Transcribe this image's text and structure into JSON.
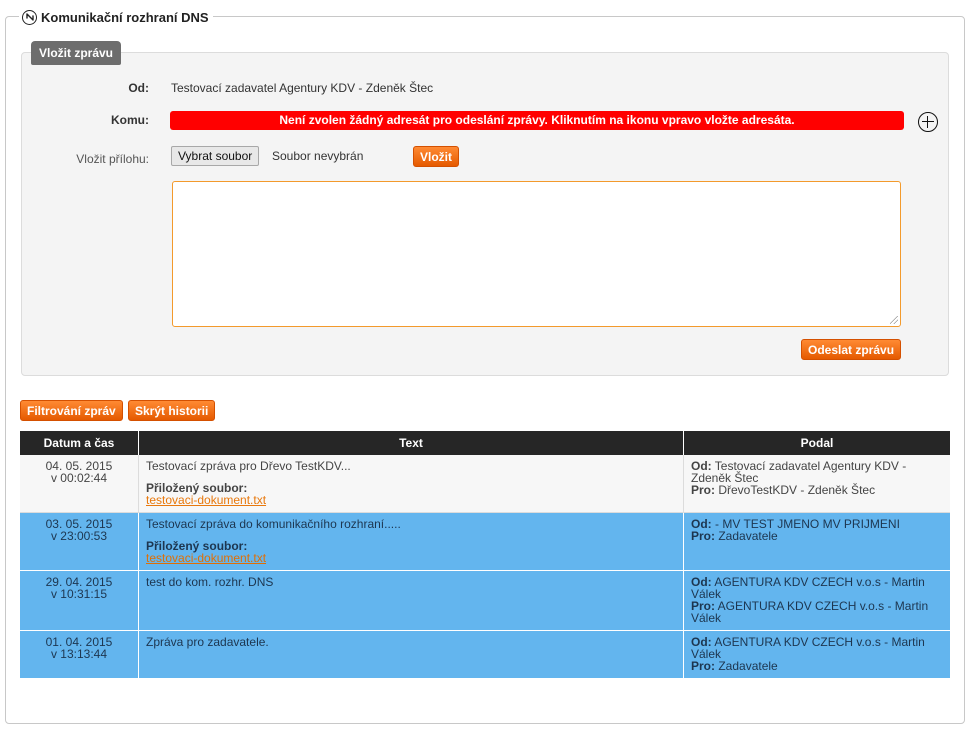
{
  "legend": {
    "title": "Komunikační rozhraní DNS",
    "icon": "circle-arrows-icon"
  },
  "compose": {
    "tab_label": "Vložit zprávu",
    "from_label": "Od:",
    "from_value": "Testovací zadavatel Agentury KDV - Zdeněk Štec",
    "to_label": "Komu:",
    "to_alert": "Není zvolen žádný adresát pro odeslání zprávy. Kliknutím na ikonu vpravo vložte adresáta.",
    "attach_label": "Vložit přílohu:",
    "file_button": "Vybrat soubor",
    "file_status": "Soubor nevybrán",
    "insert_button": "Vložit",
    "message_value": "",
    "send_button": "Odeslat zprávu",
    "colors": {
      "alert": "#ff0000",
      "accent": "#f07010"
    }
  },
  "history": {
    "filter_button": "Filtrování zpráv",
    "hide_button": "Skrýt historii",
    "columns": [
      "Datum a čas",
      "Text",
      "Podal"
    ],
    "rows": [
      {
        "style": "white",
        "date": "04. 05. 2015",
        "time": "v 00:02:44",
        "text": "Testovací zpráva pro Dřevo TestKDV...",
        "attachment_label": "Přiložený soubor:",
        "attachment": "testovaci-dokument.txt",
        "from_label": "Od:",
        "from": "Testovací zadavatel Agentury KDV - Zdeněk Štec",
        "to_label": "Pro:",
        "to": "DřevoTestKDV - Zdeněk Štec"
      },
      {
        "style": "blue",
        "date": "03. 05. 2015",
        "time": "v 23:00:53",
        "text": "Testovací zpráva do komunikačního rozhraní.....",
        "attachment_label": "Přiložený soubor:",
        "attachment": "testovaci-dokument.txt",
        "from_label": "Od:",
        "from": "- MV TEST JMENO MV PRIJMENI",
        "to_label": "Pro:",
        "to": "Zadavatele"
      },
      {
        "style": "blue",
        "date": "29. 04. 2015",
        "time": "v 10:31:15",
        "text": "test do kom. rozhr. DNS",
        "from_label": "Od:",
        "from": "AGENTURA KDV CZECH v.o.s - Martin Válek",
        "to_label": "Pro:",
        "to": "AGENTURA KDV CZECH v.o.s - Martin Válek"
      },
      {
        "style": "blue",
        "date": "01. 04. 2015",
        "time": "v 13:13:44",
        "text": "Zpráva pro zadavatele.",
        "from_label": "Od:",
        "from": "AGENTURA KDV CZECH v.o.s - Martin Válek",
        "to_label": "Pro:",
        "to": "Zadavatele"
      }
    ]
  }
}
